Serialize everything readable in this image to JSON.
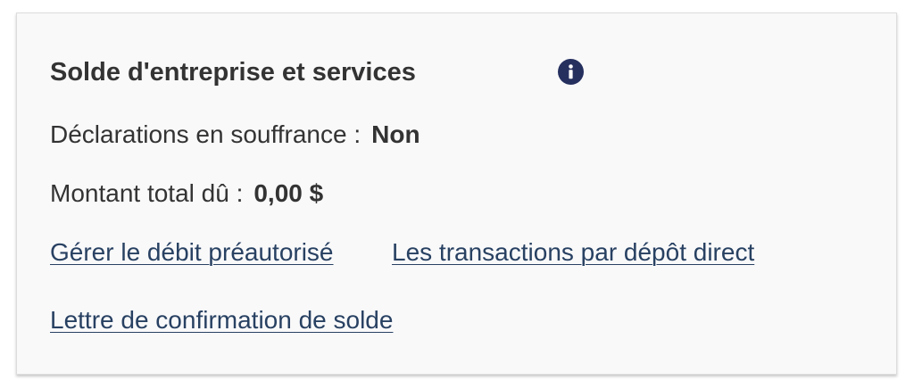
{
  "card": {
    "title": "Solde d'entreprise et services",
    "info_icon": "info-icon",
    "rows": [
      {
        "label": "Déclarations en souffrance :",
        "value": "Non"
      },
      {
        "label": "Montant total dû :",
        "value": "0,00 $"
      }
    ],
    "links": [
      "Gérer le débit préautorisé",
      "Les transactions par dépôt direct",
      "Lettre de confirmation de solde"
    ]
  },
  "colors": {
    "link": "#284162",
    "icon_bg": "#26305f",
    "text": "#333333",
    "card_bg": "#f9f9fa"
  }
}
